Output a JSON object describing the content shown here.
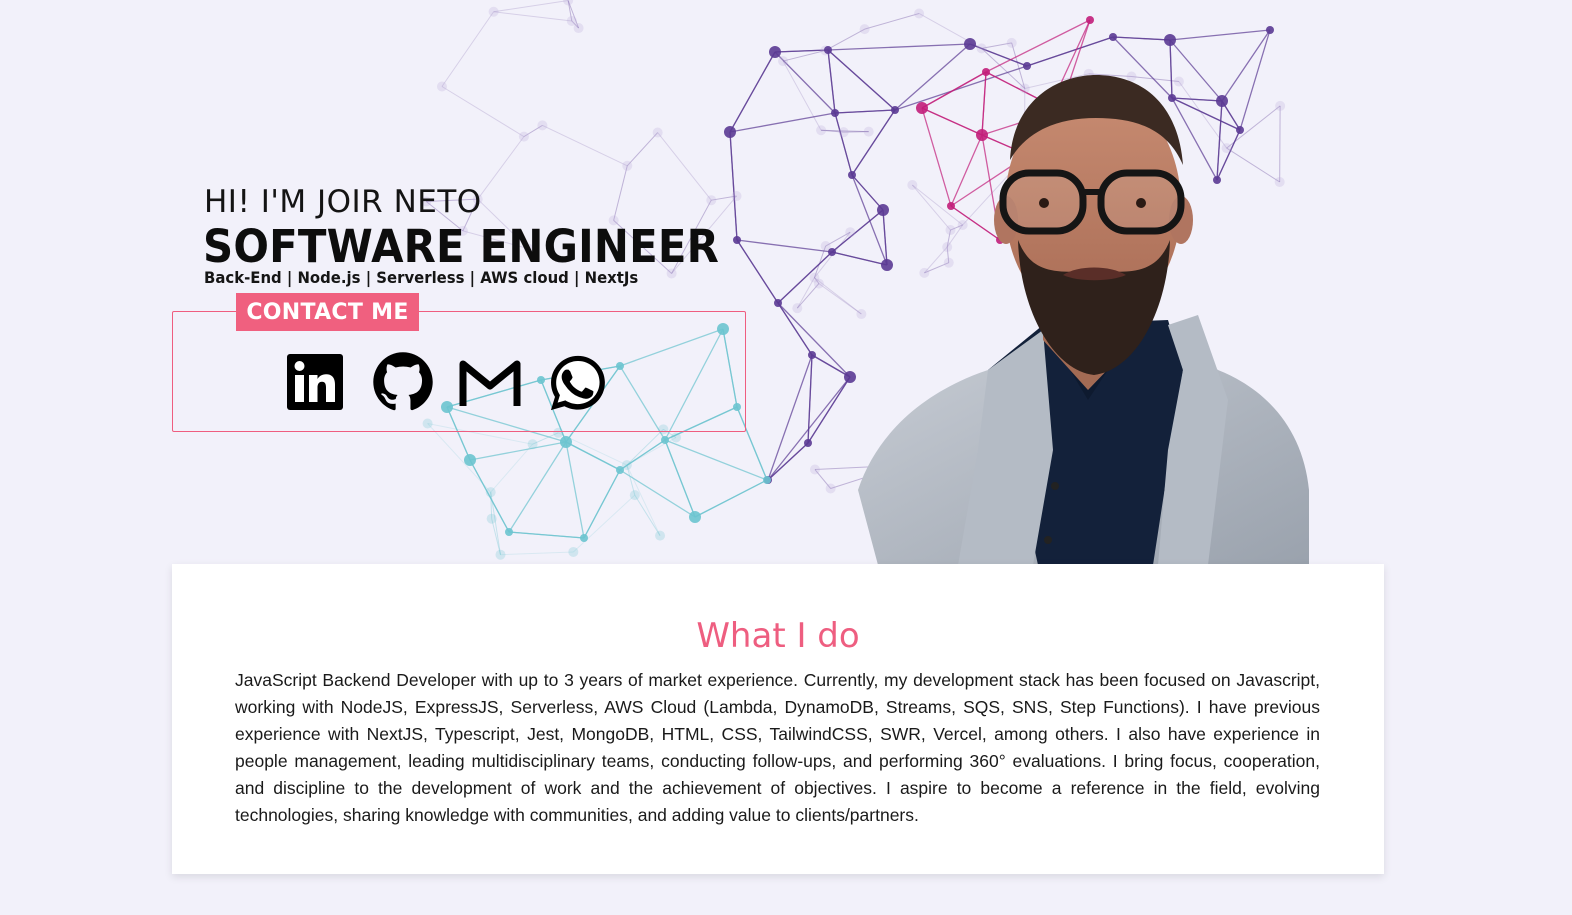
{
  "hero": {
    "greeting": "HI! I'M JOIR NETO",
    "role": "SOFTWARE ENGINEER",
    "skills": "Back-End | Node.js | Serverless | AWS cloud | NextJs"
  },
  "contact": {
    "label": "CONTACT ME",
    "links": [
      {
        "name": "linkedin",
        "icon": "linkedin-icon"
      },
      {
        "name": "github",
        "icon": "github-icon"
      },
      {
        "name": "gmail",
        "icon": "gmail-icon"
      },
      {
        "name": "whatsapp",
        "icon": "whatsapp-icon"
      }
    ]
  },
  "about": {
    "title": "What I do",
    "text": "JavaScript Backend Developer with up to 3 years of market experience. Currently, my development stack has been focused on Javascript, working with NodeJS, ExpressJS, Serverless, AWS Cloud (Lambda, DynamoDB, Streams, SQS, SNS, Step Functions). I have previous experience with NextJS, Typescript, Jest, MongoDB, HTML, CSS, TailwindCSS, SWR, Vercel, among others. I also have experience in people management, leading multidisciplinary teams, conducting follow-ups, and performing 360° evaluations. I bring focus, cooperation, and discipline to the development of work and the achievement of objectives. I aspire to become a reference in the field, evolving technologies, sharing knowledge with communities, and adding value to clients/partners."
  },
  "colors": {
    "accent": "#ef5d7f",
    "background": "#f2f1fa",
    "network_purple": "#5b3a93",
    "network_magenta": "#c21e7a",
    "network_teal": "#6cc4cf"
  }
}
